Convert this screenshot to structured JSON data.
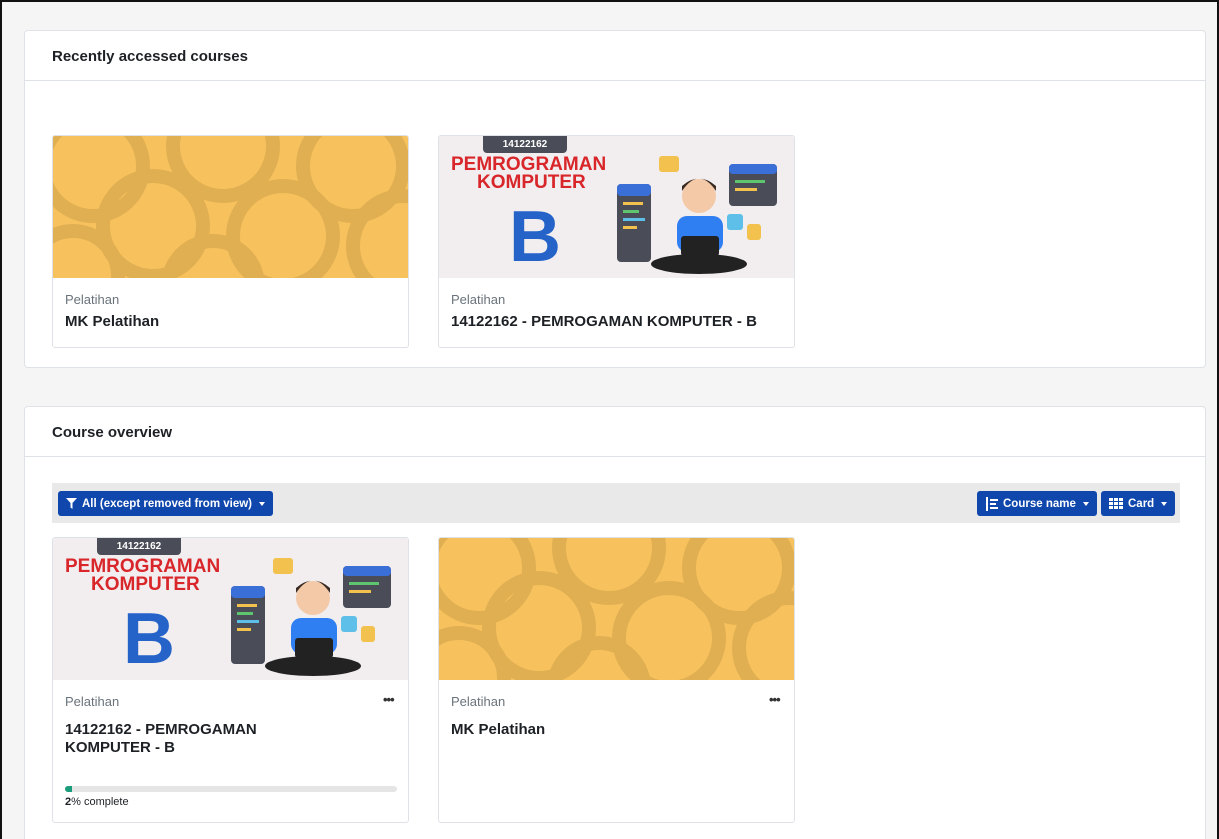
{
  "recent": {
    "title": "Recently accessed courses",
    "courses": [
      {
        "category": "Pelatihan",
        "name": "MK Pelatihan"
      },
      {
        "category": "Pelatihan",
        "name": "14122162 - PEMROGAMAN KOMPUTER - B"
      }
    ]
  },
  "overview": {
    "title": "Course overview",
    "filter_label": "All (except removed from view)",
    "sort_label": "Course name",
    "view_label": "Card",
    "courses": [
      {
        "category": "Pelatihan",
        "name": "14122162 - PEMROGAMAN KOMPUTER - B",
        "progress_value": "2",
        "progress_suffix": "% complete",
        "progress_fraction": 0.02
      },
      {
        "category": "Pelatihan",
        "name": "MK Pelatihan"
      }
    ]
  },
  "course_image": {
    "code": "14122162",
    "line1": "PEMROGRAMAN",
    "line2": "KOMPUTER",
    "letter": "B"
  },
  "colors": {
    "accent": "#0f47ad",
    "pattern": "#f7c25e",
    "progress": "#1b9c7a"
  },
  "icons": [
    "filter-icon",
    "sort-icon",
    "grid-icon",
    "more-icon"
  ]
}
